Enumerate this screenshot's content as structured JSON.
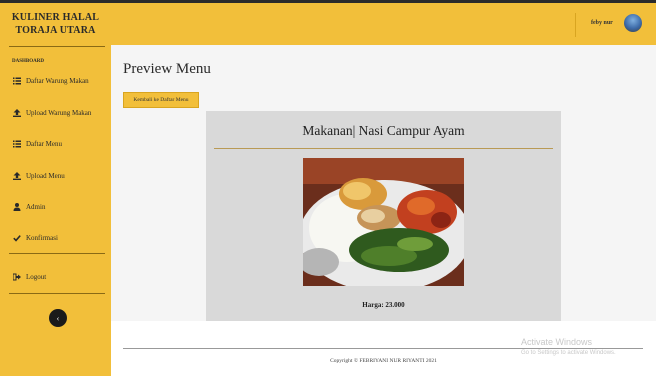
{
  "brand": {
    "line1": "KULINER HALAL",
    "line2": "TORAJA UTARA"
  },
  "sidebar": {
    "heading": "DASHBOARD",
    "items": [
      {
        "label": "Daftar Warung Makan",
        "icon": "list-icon"
      },
      {
        "label": "Upload Warung Makan",
        "icon": "upload-icon"
      },
      {
        "label": "Daftar Menu",
        "icon": "list-icon"
      },
      {
        "label": "Upload Menu",
        "icon": "upload-icon"
      },
      {
        "label": "Admin",
        "icon": "user-tie-icon"
      },
      {
        "label": "Konfirmasi",
        "icon": "check-icon"
      }
    ],
    "logout": {
      "label": "Logout",
      "icon": "sign-out-icon"
    },
    "toggle_label": "‹"
  },
  "topbar": {
    "user_name": "feby nur"
  },
  "page": {
    "title": "Preview Menu",
    "back_label": "Kembali ke Daftar Menu"
  },
  "card": {
    "title": "Makanan| Nasi Campur Ayam",
    "price": "Harga: 23.000"
  },
  "footer": {
    "copyright": "Copyright © FEBRIYANI NUR RIYANTI 2021"
  },
  "watermark": {
    "line1": "Activate Windows",
    "line2": "Go to Settings to activate Windows."
  },
  "colors": {
    "accent": "#f2bf3a",
    "card_bg": "#d9d9d9",
    "main_bg": "#f5f5f5"
  }
}
